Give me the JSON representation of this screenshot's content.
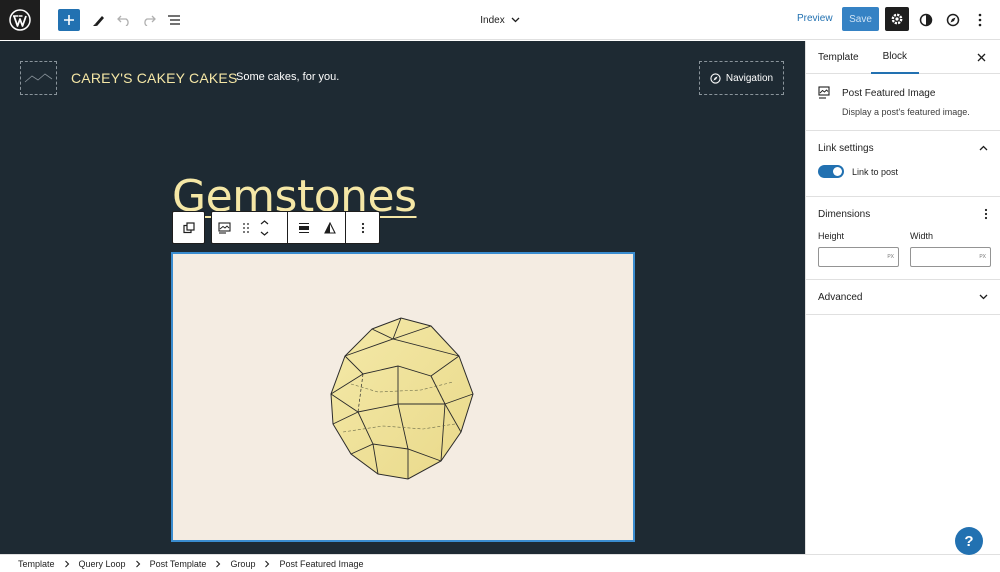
{
  "topbar": {
    "document_title": "Index",
    "preview_label": "Preview",
    "save_label": "Save"
  },
  "site": {
    "title": "CAREY'S CAKEY CAKES",
    "tagline": "Some cakes, for you.",
    "navigation_label": "Navigation"
  },
  "post": {
    "title": "Gemstones"
  },
  "sidebar": {
    "tabs": [
      {
        "label": "Template"
      },
      {
        "label": "Block"
      }
    ],
    "block_card": {
      "title": "Post Featured Image",
      "description": "Display a post's featured image."
    },
    "link_settings": {
      "title": "Link settings",
      "toggle_label": "Link to post",
      "toggle_on": true
    },
    "dimensions": {
      "title": "Dimensions",
      "height_label": "Height",
      "width_label": "Width",
      "unit": "PX"
    },
    "advanced": {
      "title": "Advanced"
    }
  },
  "breadcrumb": {
    "items": [
      "Template",
      "Query Loop",
      "Post Template",
      "Group",
      "Post Featured Image"
    ]
  },
  "help_label": "?",
  "colors": {
    "accent": "#2271b1",
    "canvas_bg": "#1e2a33",
    "site_title": "#f5e7a6",
    "image_bg": "#f4ece2"
  },
  "icons": {
    "wordpress": "wordpress-logo-icon",
    "add": "plus-icon",
    "tools": "pen-icon",
    "undo": "undo-icon",
    "redo": "redo-icon",
    "list_view": "list-view-icon",
    "settings": "gear-icon",
    "styles": "half-circle-icon",
    "site_editor": "compass-icon",
    "options": "vertical-ellipsis-icon"
  }
}
